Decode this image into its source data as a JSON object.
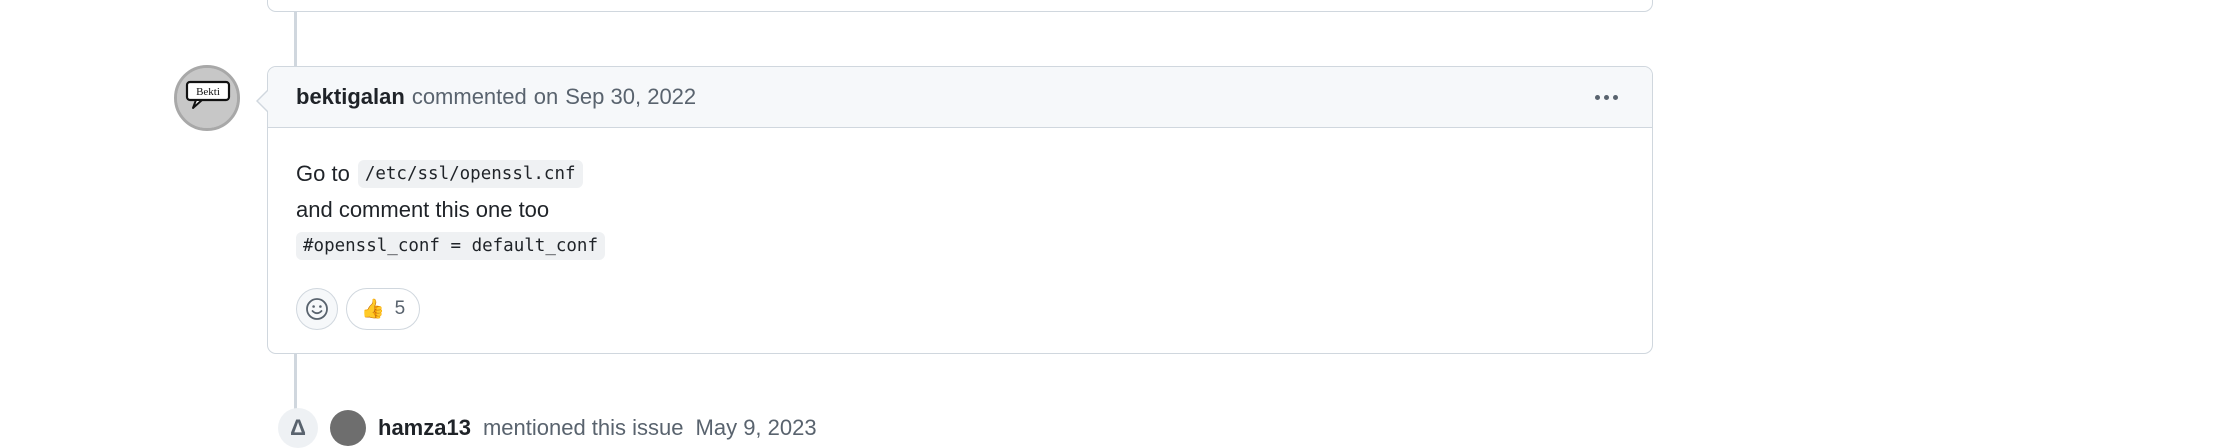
{
  "comment": {
    "author": "bektigalan",
    "action": "commented",
    "preposition": "on",
    "date": "Sep 30, 2022",
    "avatar_text": "Bekti",
    "body": {
      "line1_text": "Go to",
      "line1_code": "/etc/ssl/openssl.cnf",
      "line2_text": "and comment this one too",
      "line3_code": "#openssl_conf = default_conf"
    },
    "reactions": [
      {
        "emoji": "👍",
        "count": "5",
        "icon": "thumbs-up-icon"
      }
    ],
    "menu_icon": "kebab-horizontal-icon",
    "add_reaction_icon": "smiley-icon"
  },
  "next_event": {
    "icon": "mention-icon",
    "icon_glyph": "Δ",
    "author": "hamza13",
    "text": "mentioned this issue",
    "date": "May 9, 2023"
  },
  "colors": {
    "border": "#d0d7de",
    "header_bg": "#f6f8fa",
    "muted_text": "#59636e",
    "text": "#1f2328",
    "code_bg": "#eff1f3"
  }
}
